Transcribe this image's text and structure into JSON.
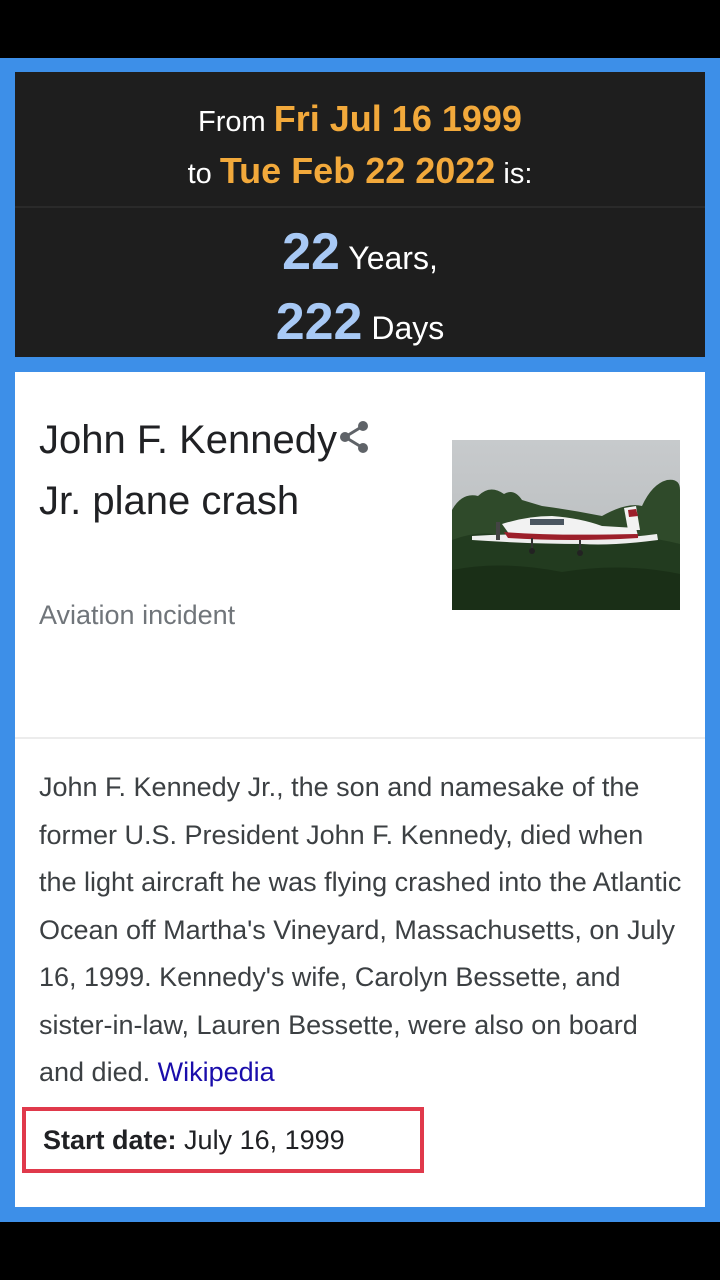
{
  "calculator": {
    "from_prefix": "From",
    "from_date": "Fri Jul 16 1999",
    "to_prefix": "to",
    "to_date": "Tue Feb 22 2022",
    "to_suffix": "is:",
    "years_value": "22",
    "years_label": "Years,",
    "days_value": "222",
    "days_label": "Days"
  },
  "card": {
    "title": "John F. Kennedy Jr. plane crash",
    "subtitle": "Aviation incident",
    "share_icon": "share-icon",
    "image_icon": "plane-photo",
    "description": "John F. Kennedy Jr., the son and namesake of the former U.S. President John F. Kennedy, died when the light aircraft he was flying crashed into the Atlantic Ocean off Martha's Vineyard, Massachusetts, on July 16, 1999. Kennedy's wife, Carolyn Bessette, and sister-in-law, Lauren Bessette, were also on board and died.",
    "source_link": "Wikipedia",
    "start_date_label": "Start date:",
    "start_date_value": "July 16, 1999"
  },
  "colors": {
    "frame": "#3d8fe8",
    "date_highlight": "#f2a93b",
    "result_number": "#a8c9f5",
    "link": "#1a0dab",
    "highlight_box": "#e0394b"
  }
}
